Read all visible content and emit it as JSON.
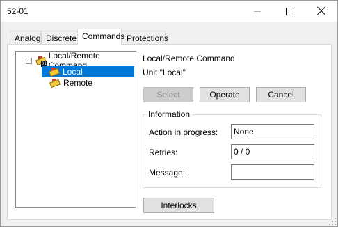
{
  "window": {
    "title": "52-01"
  },
  "tabs": [
    {
      "label": "Analog",
      "active": false
    },
    {
      "label": "Discrete",
      "active": false
    },
    {
      "label": "Commands",
      "active": true
    },
    {
      "label": "Protections",
      "active": false
    }
  ],
  "tree": {
    "root": {
      "label": "Local/Remote Command",
      "icon": "command-icon",
      "expanded": true
    },
    "children": [
      {
        "label": "Local",
        "selected": true,
        "icon": "command-item-icon"
      },
      {
        "label": "Remote",
        "selected": false,
        "icon": "command-item-icon"
      }
    ],
    "selection_color": "#0078d7"
  },
  "details": {
    "command_title": "Local/Remote Command",
    "unit_text": "Unit \"Local\""
  },
  "buttons": {
    "select": "Select",
    "operate": "Operate",
    "cancel": "Cancel",
    "interlocks": "Interlocks"
  },
  "information": {
    "legend": "Information",
    "action_label": "Action in progress:",
    "action_value": "None",
    "retries_label": "Retries:",
    "retries_value": "0 / 0",
    "message_label": "Message:",
    "message_value": ""
  }
}
